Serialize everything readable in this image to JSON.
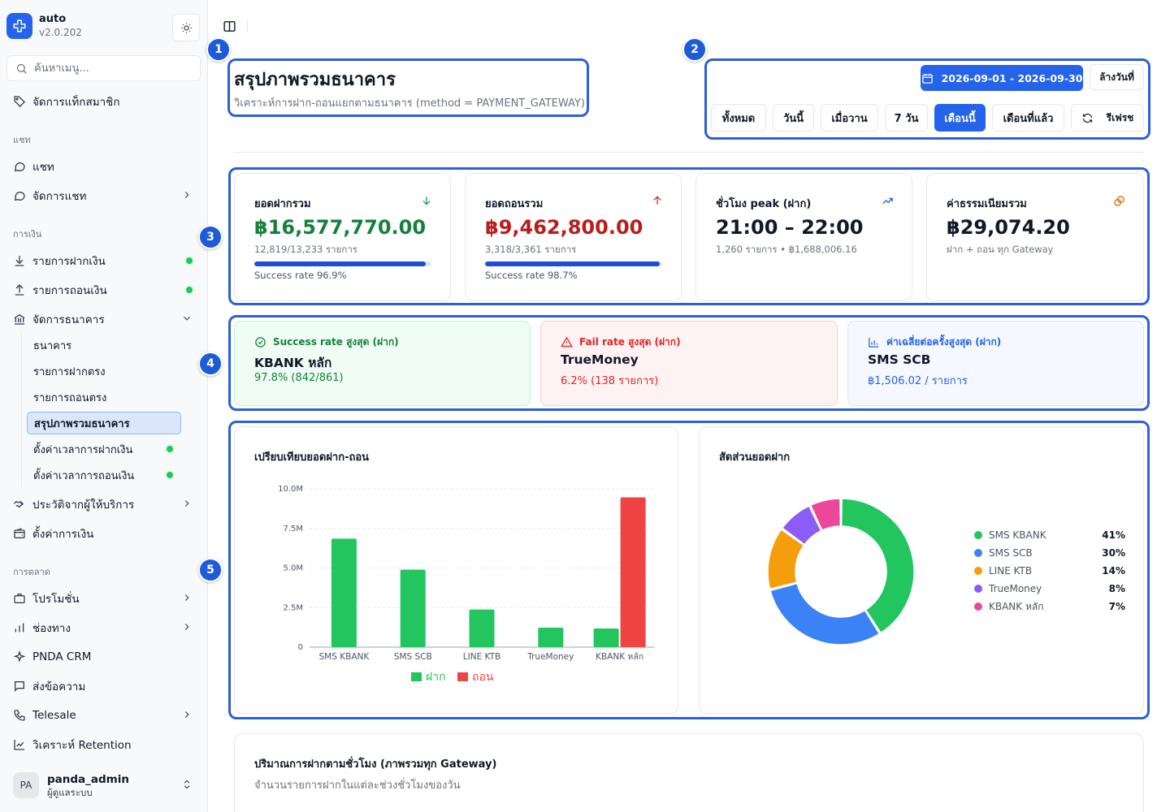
{
  "brand": {
    "name": "auto",
    "version": "v2.0.202"
  },
  "search": {
    "placeholder": "ค้นหาเมนู..."
  },
  "sidebar": {
    "top_item": "จัดการแท็กสมาชิก",
    "sections": [
      "แชท",
      "การเงิน",
      "การตลาด"
    ],
    "chat": [
      "แชท",
      "จัดการแชท"
    ],
    "finance": [
      "รายการฝากเงิน",
      "รายการถอนเงิน",
      "จัดการธนาคาร"
    ],
    "bank_sub": [
      "ธนาคาร",
      "รายการฝากตรง",
      "รายการถอนตรง",
      "สรุปภาพรวมธนาคาร",
      "ตั้งค่าเวลาการฝากเงิน",
      "ตั้งค่าเวลาการถอนเงิน"
    ],
    "finance_more": [
      "ประวัติจากผู้ให้บริการ",
      "ตั้งค่าการเงิน"
    ],
    "marketing": [
      "โปรโมชั่น",
      "ช่องทาง",
      "PNDA CRM",
      "ส่งข้อความ",
      "Telesale",
      "วิเคราะห์ Retention"
    ]
  },
  "user": {
    "initials": "PA",
    "name": "panda_admin",
    "role": "ผู้ดูแลระบบ"
  },
  "page": {
    "title": "สรุปภาพรวมธนาคาร",
    "subtitle": "วิเคราะห์การฝาก-ถอนแยกตามธนาคาร (method = PAYMENT_GATEWAY)"
  },
  "filters": {
    "date_range": "2026-09-01 - 2026-09-30",
    "clear_label": "ล้างวันที่",
    "ranges": [
      "ทั้งหมด",
      "วันนี้",
      "เมื่อวาน",
      "7 วัน",
      "เดือนนี้",
      "เดือนที่แล้ว"
    ],
    "active_range": "เดือนนี้",
    "refresh_label": "รีเฟรช"
  },
  "kpis": [
    {
      "label": "ยอดฝากรวม",
      "value": "฿16,577,770.00",
      "sub": "12,819/13,233 รายการ",
      "progress": 96.9,
      "foot": "Success rate 96.9%",
      "color": "#15803d",
      "icon": "arrow-down-icon"
    },
    {
      "label": "ยอดถอนรวม",
      "value": "฿9,462,800.00",
      "sub": "3,318/3,361 รายการ",
      "progress": 98.7,
      "foot": "Success rate 98.7%",
      "color": "#b91c1c",
      "icon": "arrow-up-icon"
    },
    {
      "label": "ชั่วโมง peak (ฝาก)",
      "value": "21:00 – 22:00",
      "sub": "1,260 รายการ • ฿1,688,006.16",
      "color": "#111827",
      "icon": "trending-up-icon"
    },
    {
      "label": "ค่าธรรมเนียมรวม",
      "value": "฿29,074.20",
      "sub": "ฝาก + ถอน ทุก Gateway",
      "color": "#111827",
      "icon": "coins-icon"
    }
  ],
  "insights": [
    {
      "head": "Success rate สูงสุด (ฝาก)",
      "name": "KBANK หลัก",
      "value": "97.8% (842/861)",
      "color": "#15803d"
    },
    {
      "head": "Fail rate สูงสุด (ฝาก)",
      "name": "TrueMoney",
      "value": "6.2% (138 รายการ)",
      "color": "#dc2626"
    },
    {
      "head": "ค่าเฉลี่ยต่อครั้งสูงสุด (ฝาก)",
      "name": "SMS SCB",
      "value": "฿1,506.02 / รายการ",
      "color": "#2563eb"
    }
  ],
  "bar_chart_title": "เปรียบเทียบยอดฝาก-ถอน",
  "donut_title": "สัดส่วนยอดฝาก",
  "hourly": {
    "title": "ปริมาณการฝากตามชั่วโมง (ภาพรวมทุก Gateway)",
    "subtitle": "จำนวนรายการฝากในแต่ละช่วงชั่วโมงของวัน"
  },
  "annotations": [
    "1",
    "2",
    "3",
    "4",
    "5"
  ],
  "chart_data": [
    {
      "type": "bar",
      "title": "เปรียบเทียบยอดฝาก-ถอน",
      "categories": [
        "SMS KBANK",
        "SMS SCB",
        "LINE KTB",
        "TrueMoney",
        "KBANK หลัก"
      ],
      "series": [
        {
          "name": "ฝาก",
          "color": "#22c55e",
          "values": [
            6850000,
            4900000,
            2380000,
            1230000,
            1180000
          ]
        },
        {
          "name": "ถอน",
          "color": "#ef4444",
          "values": [
            0,
            0,
            0,
            0,
            9460000
          ]
        }
      ],
      "yticks": [
        "0",
        "2.5M",
        "5.0M",
        "7.5M",
        "10.0M"
      ],
      "ylim": [
        0,
        10000000
      ],
      "grid": true,
      "legend": "bottom"
    },
    {
      "type": "pie",
      "title": "สัดส่วนยอดฝาก",
      "labels": [
        "SMS KBANK",
        "SMS SCB",
        "LINE KTB",
        "TrueMoney",
        "KBANK หลัก"
      ],
      "values": [
        41,
        30,
        14,
        8,
        7
      ],
      "pct_labels": [
        "41%",
        "30%",
        "14%",
        "8%",
        "7%"
      ],
      "colors": [
        "#22c55e",
        "#3b82f6",
        "#f59e0b",
        "#8b5cf6",
        "#ec4899"
      ],
      "legend": "right"
    }
  ]
}
